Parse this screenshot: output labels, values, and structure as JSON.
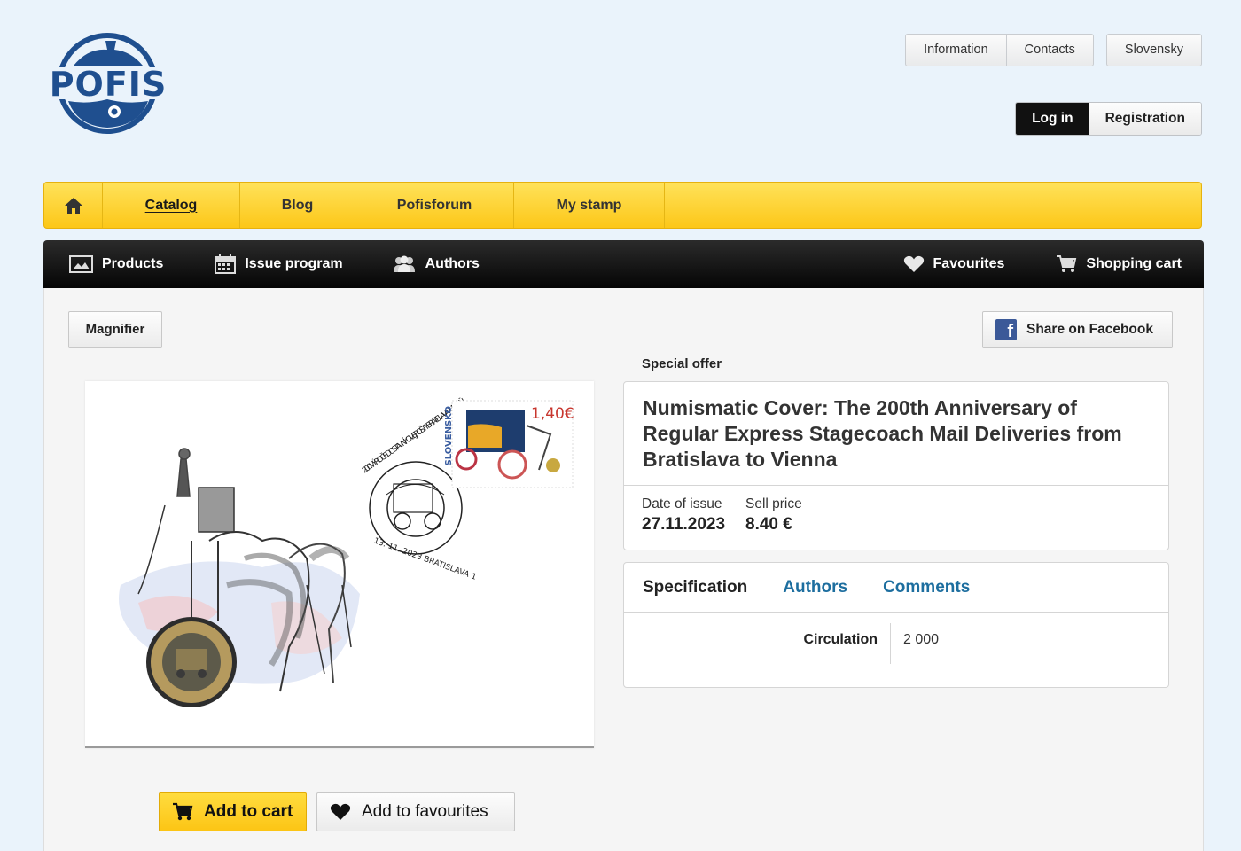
{
  "header": {
    "logo_text": "POFIS",
    "top_links": [
      "Information",
      "Contacts"
    ],
    "language": "Slovensky",
    "login": "Log in",
    "registration": "Registration"
  },
  "main_nav": {
    "home_icon": "home-icon",
    "items": [
      "Catalog",
      "Blog",
      "Pofisforum",
      "My stamp"
    ]
  },
  "sub_nav": {
    "left": [
      {
        "label": "Products",
        "icon": "image-icon"
      },
      {
        "label": "Issue program",
        "icon": "calendar-icon"
      },
      {
        "label": "Authors",
        "icon": "people-icon"
      }
    ],
    "right": [
      {
        "label": "Favourites",
        "icon": "heart-icon"
      },
      {
        "label": "Shopping cart",
        "icon": "cart-icon"
      }
    ]
  },
  "toolbar": {
    "magnifier": "Magnifier",
    "share": "Share on Facebook"
  },
  "product": {
    "badge": "Special offer",
    "title": "Numismatic Cover: The 200th Anniversary of Regular Express Stagecoach Mail Deliveries from Bratislava to Vienna",
    "date_label": "Date of issue",
    "date_value": "27.11.2023",
    "price_label": "Sell price",
    "price_value": "8.40 €",
    "stamp_price": "1,40€",
    "stamp_country": "SLOVENSKO",
    "postmark_top": "200. VÝROČIE DOSTAVNÍKOVEJ POŠTY BRATISLAVA – VIEDEŇ",
    "postmark_bottom": "13. 11. 2023 BRATISLAVA 1"
  },
  "tabs": {
    "items": [
      "Specification",
      "Authors",
      "Comments"
    ],
    "active": "Specification"
  },
  "specification": {
    "label": "Circulation",
    "value": "2 000"
  },
  "actions": {
    "add_to_cart": "Add to cart",
    "add_to_favourites": "Add to favourites"
  },
  "colors": {
    "brand_blue": "#1f4f8f",
    "yellow": "#fcc718",
    "link_blue": "#1d6e9f"
  }
}
